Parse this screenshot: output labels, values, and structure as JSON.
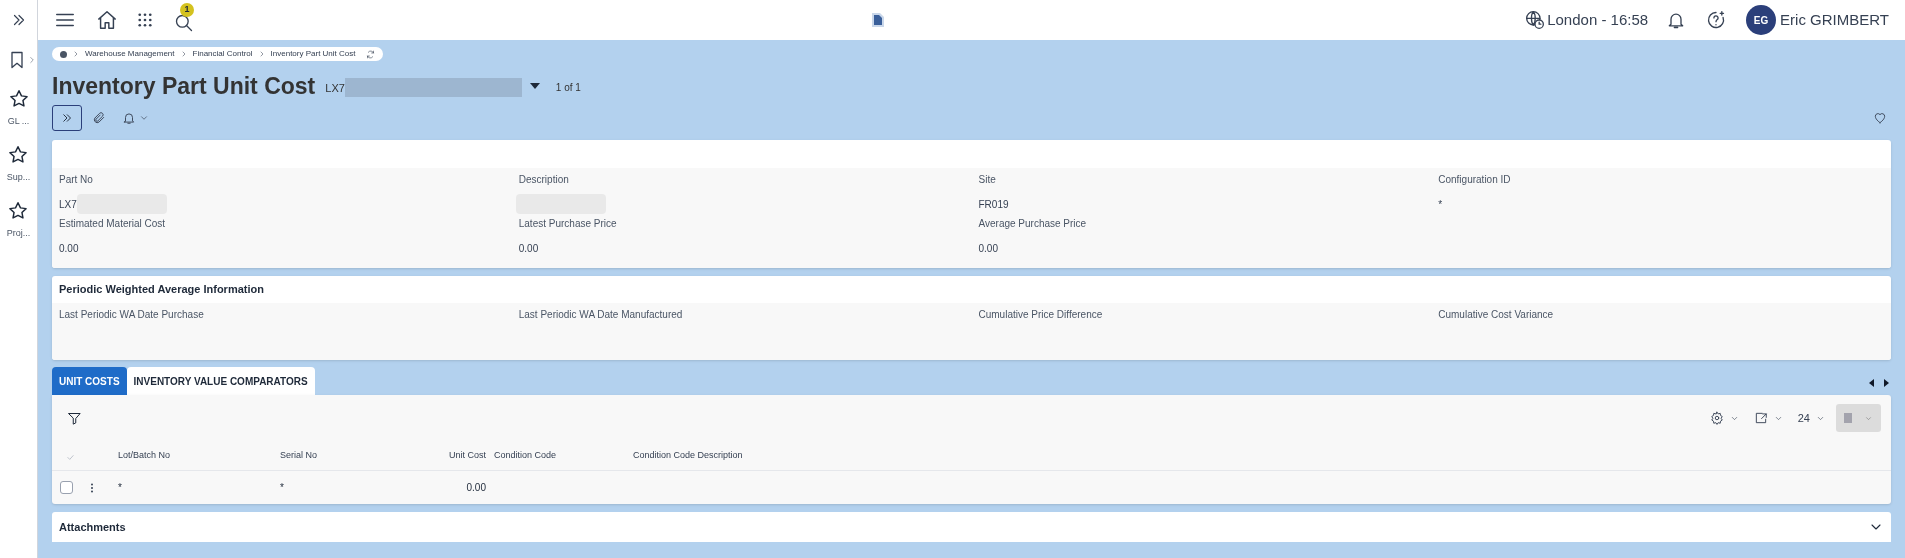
{
  "rail": {
    "items": [
      {
        "label": "GL ..."
      },
      {
        "label": "Sup..."
      },
      {
        "label": "Proj..."
      }
    ]
  },
  "topbar": {
    "search_badge": "1",
    "location_time": "London - 16:58",
    "user_initials": "EG",
    "user_name": "Eric GRIMBERT"
  },
  "breadcrumb": [
    "Warehouse Management",
    "Financial Control",
    "Inventory Part Unit Cost"
  ],
  "page": {
    "title": "Inventory Part Unit Cost",
    "record_key": "LX7",
    "record_count": "1 of 1"
  },
  "details": {
    "fields": [
      {
        "label": "Part No",
        "value": "LX7",
        "redacted": true
      },
      {
        "label": "Description",
        "redacted": true
      },
      {
        "label": "Site",
        "value": "FR019",
        "redacted": false
      },
      {
        "label": "Configuration ID",
        "value": "*",
        "redacted": false
      },
      {
        "label": "Estimated Material Cost",
        "value": "0.00",
        "redacted": false
      },
      {
        "label": "Latest Purchase Price",
        "value": "0.00",
        "redacted": false
      },
      {
        "label": "Average Purchase Price",
        "value": "0.00",
        "redacted": false
      }
    ]
  },
  "periodic": {
    "title": "Periodic Weighted Average Information",
    "fields": [
      {
        "label": "Last Periodic WA Date Purchase"
      },
      {
        "label": "Last Periodic WA Date Manufactured"
      },
      {
        "label": "Cumulative Price Difference"
      },
      {
        "label": "Cumulative Cost Variance"
      }
    ]
  },
  "tabs": [
    {
      "label": "UNIT COSTS",
      "selected": true
    },
    {
      "label": "INVENTORY VALUE COMPARATORS",
      "selected": false
    }
  ],
  "table": {
    "page_size": "24",
    "columns": [
      {
        "label": "Lot/Batch No"
      },
      {
        "label": "Serial No"
      },
      {
        "label": "Unit Cost"
      },
      {
        "label": "Condition Code"
      },
      {
        "label": "Condition Code Description"
      }
    ],
    "rows": [
      {
        "checked": false,
        "cells": [
          "*",
          "*",
          "0.00",
          "",
          ""
        ]
      }
    ]
  },
  "attachments": {
    "title": "Attachments",
    "expanded": false
  }
}
